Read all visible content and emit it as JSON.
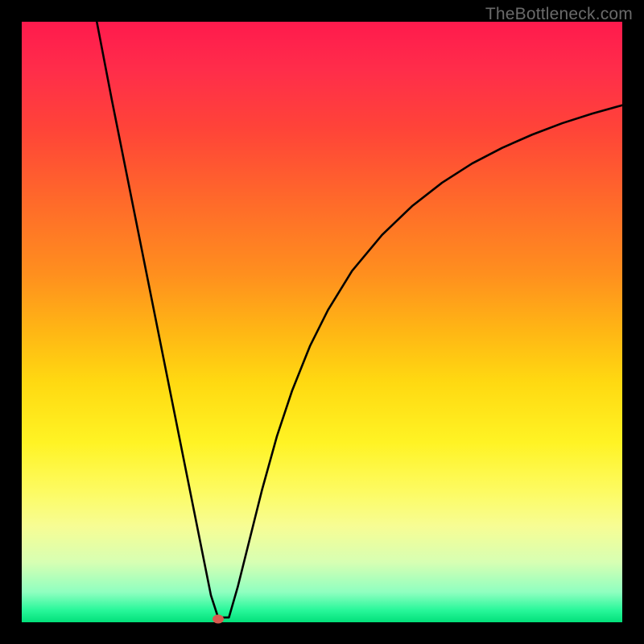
{
  "watermark": "TheBottleneck.com",
  "colors": {
    "frame": "#000000",
    "gradient_top": "#ff1a4d",
    "gradient_bottom": "#02e07a",
    "curve": "#000000",
    "marker": "#d85a4f"
  },
  "chart_data": {
    "type": "line",
    "title": "",
    "xlabel": "",
    "ylabel": "",
    "xlim": [
      0,
      100
    ],
    "ylim": [
      0,
      100
    ],
    "marker": {
      "x": 32.7,
      "y": 0.5
    },
    "series": [
      {
        "name": "left-branch",
        "x": [
          12.5,
          15,
          17.5,
          20,
          22.5,
          25,
          27.5,
          30,
          31.5,
          32.7
        ],
        "y": [
          100,
          87,
          74.5,
          62,
          49.5,
          37,
          24.5,
          12,
          4.5,
          0.8
        ]
      },
      {
        "name": "dip-flat",
        "x": [
          32.7,
          34.5
        ],
        "y": [
          0.8,
          0.8
        ]
      },
      {
        "name": "right-branch",
        "x": [
          34.5,
          36,
          38,
          40,
          42.5,
          45,
          48,
          51,
          55,
          60,
          65,
          70,
          75,
          80,
          85,
          90,
          95,
          100
        ],
        "y": [
          0.8,
          6,
          14,
          22,
          31,
          38.5,
          46,
          52,
          58.5,
          64.5,
          69.3,
          73.2,
          76.4,
          79,
          81.2,
          83.1,
          84.7,
          86.1
        ]
      }
    ]
  }
}
